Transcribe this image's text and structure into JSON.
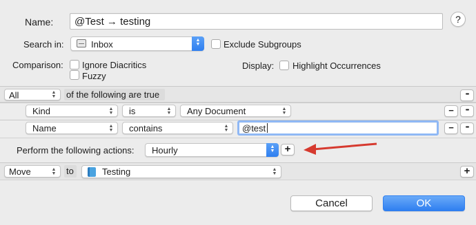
{
  "name": {
    "label": "Name:",
    "value": "@Test → testing"
  },
  "help": {
    "glyph": "?"
  },
  "search_in": {
    "label": "Search in:",
    "value": "Inbox",
    "icon": "inbox-icon"
  },
  "exclude_subgroups": {
    "label": "Exclude Subgroups",
    "checked": false
  },
  "comparison": {
    "label": "Comparison:",
    "options": [
      {
        "label": "Ignore Diacritics",
        "checked": false
      },
      {
        "label": "Fuzzy",
        "checked": false
      }
    ]
  },
  "display": {
    "label": "Display:",
    "option": {
      "label": "Highlight Occurrences",
      "checked": false
    }
  },
  "criteria": {
    "match": "All",
    "suffix": "of the following are true",
    "more_glyph": "•••",
    "rows": [
      {
        "field": "Kind",
        "operator": "is",
        "value": "Any Document",
        "remove_glyph": "−",
        "more_glyph": "•••"
      },
      {
        "field": "Name",
        "operator": "contains",
        "value": "@test",
        "remove_glyph": "−",
        "more_glyph": "•••"
      }
    ]
  },
  "actions": {
    "label": "Perform the following actions:",
    "schedule": "Hourly",
    "add_glyph": "+",
    "annotation_color": "#d63a2f"
  },
  "action_row": {
    "action": "Move",
    "connector": "to",
    "destination": "Testing",
    "destination_icon": "group-folder-icon",
    "add_glyph": "+"
  },
  "footer": {
    "cancel": "Cancel",
    "ok": "OK"
  },
  "colors": {
    "accent": "#2f7ff0",
    "ok_button": "#3d8cf4",
    "folder": "#4aa3e0"
  }
}
